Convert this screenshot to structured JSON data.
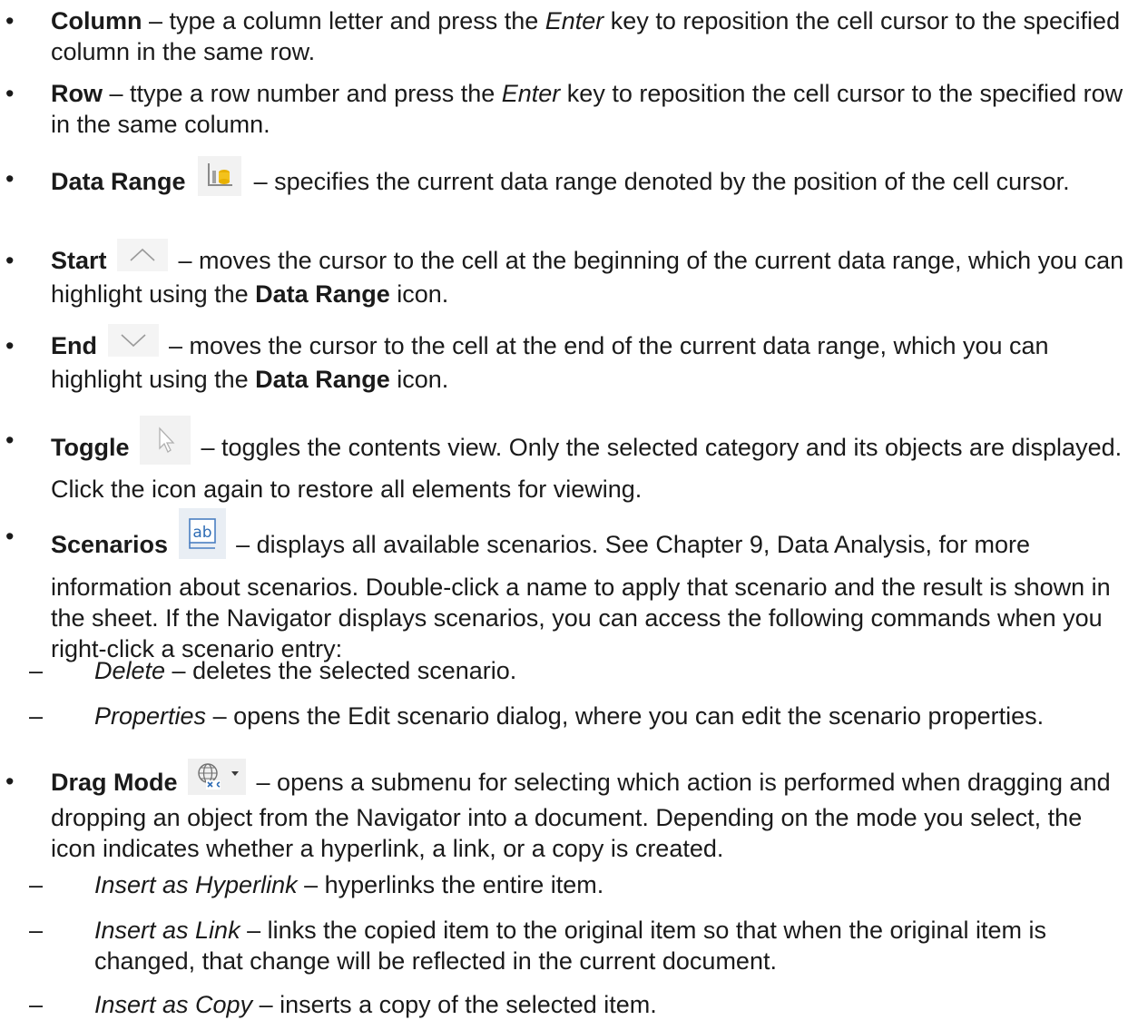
{
  "items": [
    {
      "term": "Column",
      "pre": " – type a column letter and press the ",
      "em": "Enter",
      "post": " key to reposition the cell cursor to the specified column in the same row."
    },
    {
      "term": "Row",
      "pre": " –  ttype a row number and press the ",
      "em": "Enter",
      "post": " key to reposition the cell cursor to the specified row in the same column."
    },
    {
      "term": "Data Range",
      "icon": "data-range-icon",
      "text": " – specifies the current data range denoted by the position of the cell cursor."
    },
    {
      "term": "Start",
      "icon": "chevron-up-icon",
      "pre": " – moves the cursor to the cell at the beginning of the current data range, which you can highlight using the ",
      "bold": "Data Range",
      "post": " icon."
    },
    {
      "term": "End",
      "icon": "chevron-down-icon",
      "pre": " – moves the cursor to the cell at the end of the current data range, which you can highlight using the ",
      "bold": "Data Range",
      "post": " icon."
    },
    {
      "term": "Toggle",
      "icon": "pointer-icon",
      "text": " – toggles the contents view. Only the selected category and its objects are displayed. Click the icon again to restore all elements for viewing."
    },
    {
      "term": "Scenarios",
      "icon": "scenarios-icon",
      "text": " – displays all available scenarios. See Chapter 9, Data Analysis, for more information about scenarios. Double-click a name to apply that scenario and the result is shown in the sheet. If the Navigator displays scenarios, you can access the following commands when you right-click a scenario entry:"
    },
    {
      "term": "Drag Mode",
      "icon": "drag-mode-icon",
      "text": " – opens a submenu for selecting which action is performed when dragging and dropping an object from the Navigator into a document. Depending on the mode you select, the icon indicates whether a hyperlink, a link, or a copy is created."
    }
  ],
  "scenario_commands": [
    {
      "dash": "–",
      "term": "Delete",
      "text": " – deletes the selected scenario."
    },
    {
      "dash": "–",
      "term": "Properties",
      "text": " – opens the Edit scenario dialog, where you can edit the scenario properties."
    }
  ],
  "drag_modes": [
    {
      "dash": "–",
      "term": "Insert as Hyperlink",
      "text": " – hyperlinks the entire item."
    },
    {
      "dash": "–",
      "term": "Insert as Link",
      "text": " – links the copied item to the original item so that when the original item is changed, that change will be reflected in the current document."
    },
    {
      "dash": "–",
      "term": "Insert as Copy",
      "text": " – inserts a copy of the selected item."
    }
  ]
}
